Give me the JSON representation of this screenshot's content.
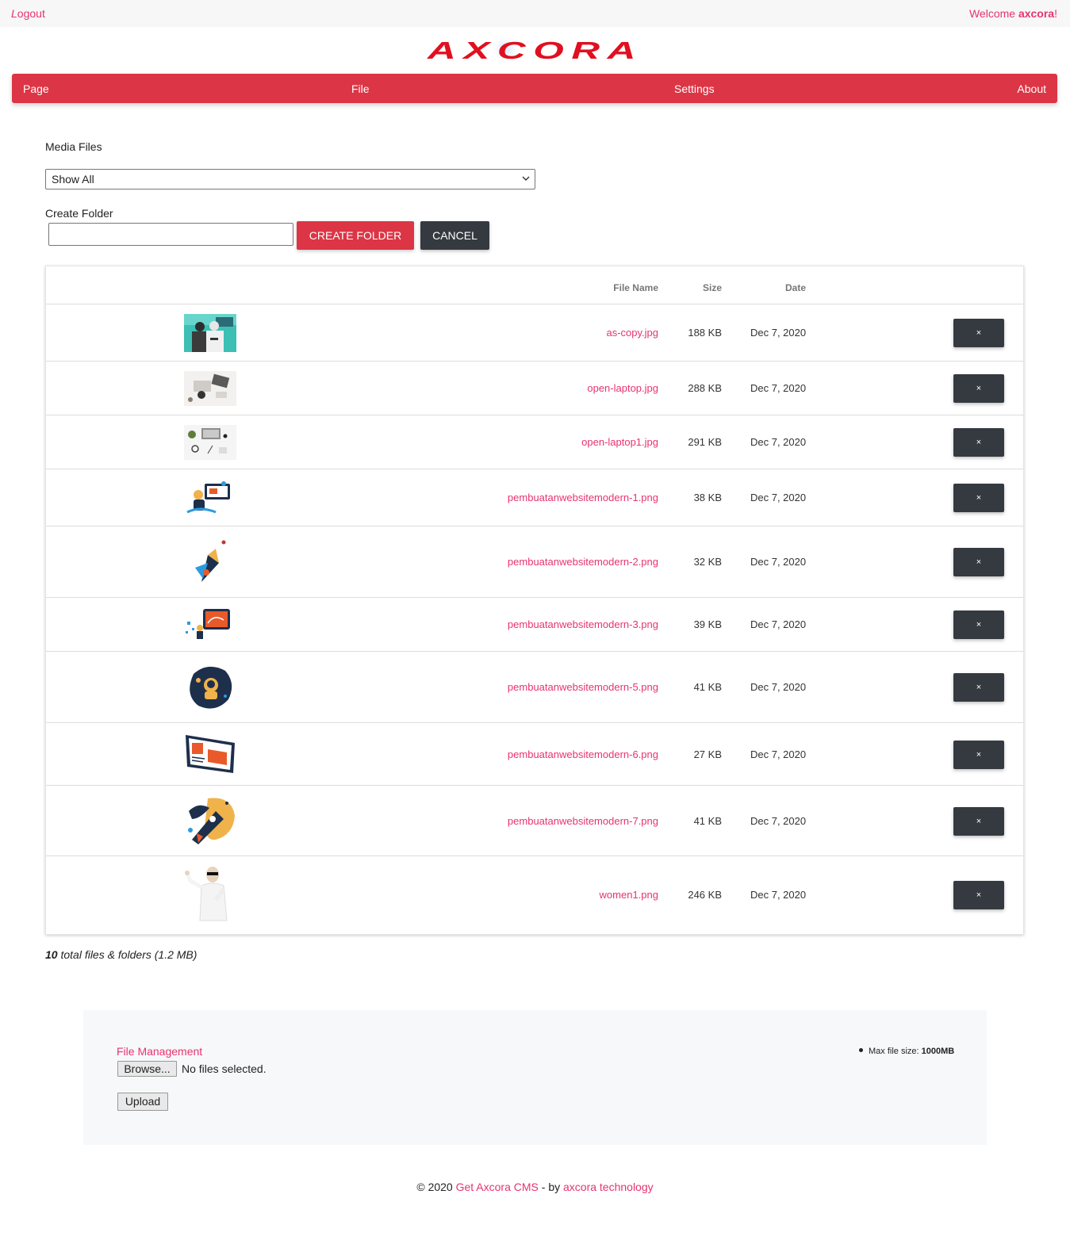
{
  "topbar": {
    "logout_first": "L",
    "logout_rest": "ogout",
    "welcome_prefix": "Welcome ",
    "welcome_user": "axcora",
    "welcome_suffix": "!"
  },
  "logo": {
    "text": "AXCORA",
    "color": "#e01020"
  },
  "nav": {
    "items": [
      "Page",
      "File",
      "Settings",
      "About"
    ],
    "color": "#dc3545"
  },
  "media": {
    "label": "Media Files",
    "filter_value": "Show All",
    "create_folder_label": "Create Folder",
    "folder_input_value": "",
    "create_button": "CREATE FOLDER",
    "cancel_button": "CANCEL"
  },
  "table": {
    "headers": {
      "name": "File Name",
      "size": "Size",
      "date": "Date"
    },
    "delete_label": "×",
    "rows": [
      {
        "thumb": "photo-couple-hoodie",
        "name": "as-copy.jpg",
        "size": "188 KB",
        "date": "Dec 7, 2020"
      },
      {
        "thumb": "photo-laptop-desk",
        "name": "open-laptop.jpg",
        "size": "288 KB",
        "date": "Dec 7, 2020"
      },
      {
        "thumb": "photo-laptop-desk-2",
        "name": "open-laptop1.jpg",
        "size": "291 KB",
        "date": "Dec 7, 2020"
      },
      {
        "thumb": "illustration-web-design",
        "name": "pembuatanwebsitemodern-1.png",
        "size": "38 KB",
        "date": "Dec 7, 2020"
      },
      {
        "thumb": "illustration-rocket-person",
        "name": "pembuatanwebsitemodern-2.png",
        "size": "32 KB",
        "date": "Dec 7, 2020"
      },
      {
        "thumb": "illustration-presentation",
        "name": "pembuatanwebsitemodern-3.png",
        "size": "39 KB",
        "date": "Dec 7, 2020"
      },
      {
        "thumb": "illustration-astronaut",
        "name": "pembuatanwebsitemodern-5.png",
        "size": "41 KB",
        "date": "Dec 7, 2020"
      },
      {
        "thumb": "illustration-monitor",
        "name": "pembuatanwebsitemodern-6.png",
        "size": "27 KB",
        "date": "Dec 7, 2020"
      },
      {
        "thumb": "illustration-rocket",
        "name": "pembuatanwebsitemodern-7.png",
        "size": "41 KB",
        "date": "Dec 7, 2020"
      },
      {
        "thumb": "photo-woman-sunglasses",
        "name": "women1.png",
        "size": "246 KB",
        "date": "Dec 7, 2020"
      }
    ]
  },
  "summary": {
    "count": "10",
    "text": " total files & folders (1.2 MB)"
  },
  "upload": {
    "title": "File Management",
    "browse_label": "Browse...",
    "no_file": "No files selected.",
    "upload_label": "Upload",
    "max_prefix": "Max file size: ",
    "max_value": "1000MB"
  },
  "footer": {
    "prefix": "© 2020 ",
    "link1": "Get Axcora CMS",
    "middle": " - by ",
    "link2": "axcora technology"
  },
  "colors": {
    "accent": "#e8336e",
    "primary": "#dc3545",
    "dark": "#343a40"
  }
}
